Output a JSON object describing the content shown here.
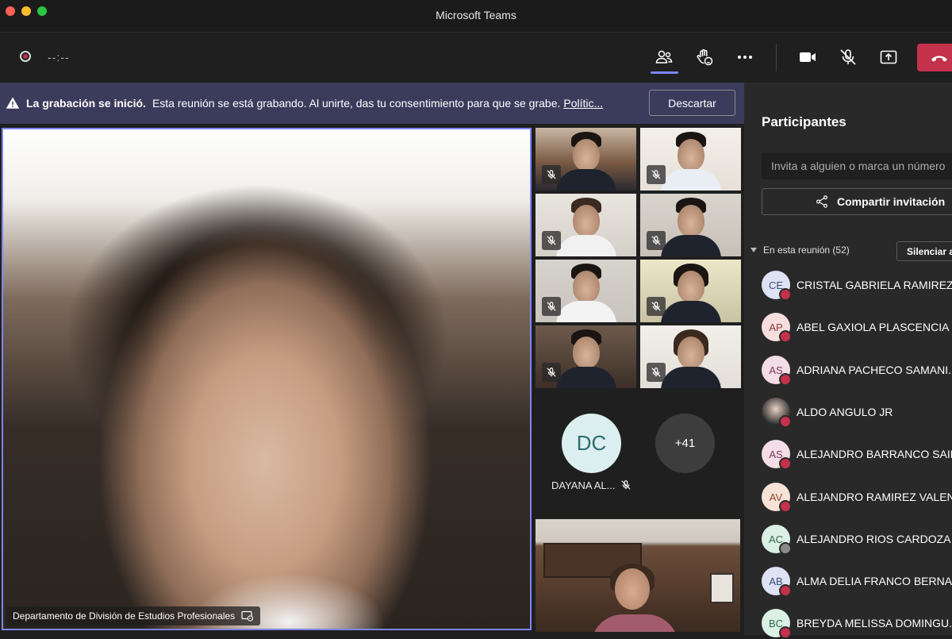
{
  "window": {
    "title": "Microsoft Teams"
  },
  "toolbar": {
    "timer": "--:--",
    "icons": [
      "people-icon",
      "raise-hand-icon",
      "more-options-icon",
      "camera-icon",
      "mic-off-icon",
      "share-screen-icon",
      "hang-up-icon"
    ]
  },
  "banner": {
    "bold_text": "La grabación se inició.",
    "message": "Esta reunión se está grabando. Al unirte, das tu consentimiento para que se grabe.",
    "link": "Polític...",
    "dismiss_label": "Descartar"
  },
  "stage": {
    "presenter_label": "Departamento de División de Estudios Profesionales"
  },
  "gallery": {
    "dc_initials": "DC",
    "dc_name": "DAYANA AL...",
    "more_count": "+41"
  },
  "panel": {
    "title": "Participantes",
    "invite_placeholder": "Invita a alguien o marca un número",
    "share_invite_label": "Compartir invitación",
    "in_meeting_label": "En esta reunión (52)",
    "mute_all_label": "Silenciar a",
    "participants": [
      {
        "initials": "CE",
        "name": "CRISTAL GABRIELA RAMIREZ ...",
        "status": "red"
      },
      {
        "initials": "AP",
        "name": "ABEL GAXIOLA PLASCENCIA",
        "status": "red"
      },
      {
        "initials": "AS",
        "name": "ADRIANA PACHECO SAMANI...",
        "status": "red"
      },
      {
        "initials": "",
        "name": "ALDO ANGULO JR",
        "status": "red"
      },
      {
        "initials": "AS",
        "name": "ALEJANDRO BARRANCO SAIN",
        "status": "red"
      },
      {
        "initials": "AV",
        "name": "ALEJANDRO RAMIREZ VALEN",
        "status": "red"
      },
      {
        "initials": "AC",
        "name": "ALEJANDRO RIOS CARDOZA",
        "status": "off"
      },
      {
        "initials": "AB",
        "name": "ALMA DELIA FRANCO BERNAL",
        "status": "red"
      },
      {
        "initials": "BC",
        "name": "BREYDA MELISSA DOMINGU...",
        "status": "red"
      }
    ]
  },
  "colors": {
    "accent": "#7f85f5",
    "hangup": "#c4314b",
    "banner_bg": "#3b3b5c",
    "panel_bg": "#292929"
  }
}
